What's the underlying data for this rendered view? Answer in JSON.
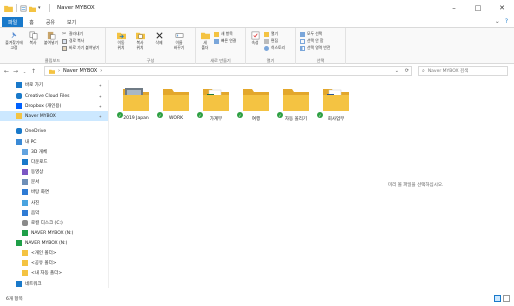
{
  "window": {
    "title": "Naver MYBOX"
  },
  "ribbon_tabs": [
    "파일",
    "홈",
    "공유",
    "보기"
  ],
  "ribbon": {
    "clipboard": {
      "label": "클립보드",
      "pin": "즐겨찾기에\n고정",
      "copy": "복사",
      "paste": "붙여넣기",
      "cut": "잘라내기",
      "copy_path": "경로 복사",
      "paste_shortcut": "바로 가기 붙여넣기"
    },
    "organize": {
      "label": "구성",
      "move_to": "이동\n위치",
      "copy_to": "복사\n위치",
      "delete": "삭제",
      "rename": "이름\n바꾸기"
    },
    "new": {
      "label": "새로 만들기",
      "new_folder": "새\n폴더",
      "new_item": "새 항목",
      "easy_access": "빠른 연결"
    },
    "open": {
      "label": "열기",
      "properties": "속성",
      "open": "열기",
      "edit": "편집",
      "history": "히스토리"
    },
    "select": {
      "label": "선택",
      "select_all": "모두 선택",
      "select_none": "선택 안 함",
      "invert": "선택 영역 반전"
    }
  },
  "address": {
    "crumb": "Naver MYBOX",
    "search_placeholder": "Naver MYBOX 검색"
  },
  "nav": {
    "items": [
      {
        "label": "바로 가기",
        "icon": "star-icon",
        "indent": 0
      },
      {
        "label": "Creative Cloud Files",
        "icon": "cloud-icon",
        "indent": 0
      },
      {
        "label": "Dropbox (개인용)",
        "icon": "dropbox-icon",
        "indent": 0
      },
      {
        "label": "Naver MYBOX",
        "icon": "folder-icon",
        "indent": 0,
        "selected": true
      },
      {
        "label": "OneDrive",
        "icon": "cloud-icon",
        "indent": 0
      },
      {
        "label": "내 PC",
        "icon": "pc-icon",
        "indent": 0
      },
      {
        "label": "3D 개체",
        "icon": "cube-icon",
        "indent": 1
      },
      {
        "label": "다운로드",
        "icon": "download-icon",
        "indent": 1
      },
      {
        "label": "동영상",
        "icon": "video-icon",
        "indent": 1
      },
      {
        "label": "문서",
        "icon": "document-icon",
        "indent": 1
      },
      {
        "label": "바탕 화면",
        "icon": "desktop-icon",
        "indent": 1
      },
      {
        "label": "사진",
        "icon": "picture-icon",
        "indent": 1
      },
      {
        "label": "음악",
        "icon": "music-icon",
        "indent": 1
      },
      {
        "label": "로컬 디스크 (C:)",
        "icon": "disk-icon",
        "indent": 1
      },
      {
        "label": "NAVER MYBOX (N:)",
        "icon": "drive-icon",
        "indent": 1
      },
      {
        "label": "NAVER MYBOX (N:)",
        "icon": "drive-icon",
        "indent": 0
      },
      {
        "label": "<개인 폴더>",
        "icon": "folder-icon",
        "indent": 1
      },
      {
        "label": "<공유 폴더>",
        "icon": "folder-icon",
        "indent": 1
      },
      {
        "label": "<내 자동 폴더>",
        "icon": "folder-icon",
        "indent": 1
      },
      {
        "label": "네트워크",
        "icon": "network-icon",
        "indent": 0
      }
    ]
  },
  "folders": [
    {
      "label": "2019 Japan",
      "type": "photo"
    },
    {
      "label": "WORK",
      "type": "plain"
    },
    {
      "label": "가계부",
      "type": "excel"
    },
    {
      "label": "여행",
      "type": "plain"
    },
    {
      "label": "자동 올리기",
      "type": "plain"
    },
    {
      "label": "회사업무",
      "type": "word"
    }
  ],
  "preview_message": "미리 볼 파일을 선택하십시오.",
  "status": {
    "count": "6개 항목"
  },
  "colors": {
    "accent": "#1979ca",
    "folder": "#f4c342",
    "folder_dark": "#e3a72b",
    "selected": "#cce8ff",
    "check": "#2ea043"
  }
}
